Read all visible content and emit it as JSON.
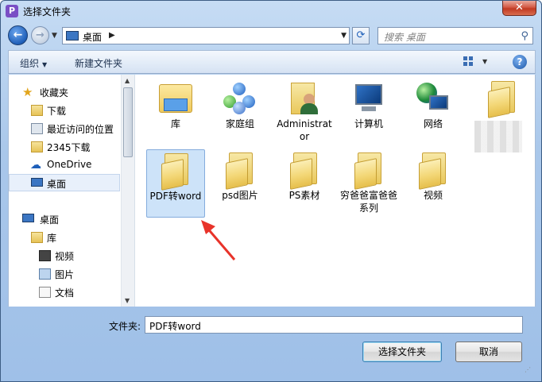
{
  "window": {
    "title": "选择文件夹",
    "app_icon_letter": "P",
    "close_glyph": "✕"
  },
  "address": {
    "location": "桌面",
    "search_placeholder": "搜索 桌面"
  },
  "toolbar": {
    "organize_label": "组织",
    "new_folder_label": "新建文件夹"
  },
  "nav_tree": [
    {
      "label": "收藏夹",
      "icon": "star-icon"
    },
    {
      "label": "下载",
      "icon": "download-folder-icon"
    },
    {
      "label": "最近访问的位置",
      "icon": "recent-places-icon"
    },
    {
      "label": "2345下载",
      "icon": "folder-icon"
    },
    {
      "label": "OneDrive",
      "icon": "cloud-icon"
    },
    {
      "label": "桌面",
      "icon": "desktop-icon",
      "selected": true
    },
    {
      "label": "桌面",
      "icon": "desktop-icon"
    },
    {
      "label": "库",
      "icon": "library-icon"
    },
    {
      "label": "视频",
      "icon": "video-icon"
    },
    {
      "label": "图片",
      "icon": "pictures-icon"
    },
    {
      "label": "文档",
      "icon": "documents-icon"
    }
  ],
  "items": [
    {
      "label": "库",
      "icon": "library-icon"
    },
    {
      "label": "家庭组",
      "icon": "homegroup-icon"
    },
    {
      "label": "Administrator",
      "icon": "user-folder-icon"
    },
    {
      "label": "计算机",
      "icon": "computer-icon"
    },
    {
      "label": "网络",
      "icon": "network-icon"
    },
    {
      "label": "",
      "icon": "folder-icon"
    },
    {
      "label": "PDF转word",
      "icon": "folder-icon",
      "selected": true
    },
    {
      "label": "psd图片",
      "icon": "folder-icon"
    },
    {
      "label": "PS素材",
      "icon": "folder-icon"
    },
    {
      "label": "穷爸爸富爸爸系列",
      "icon": "folder-icon"
    },
    {
      "label": "视频",
      "icon": "folder-icon"
    }
  ],
  "bottom": {
    "folder_label": "文件夹:",
    "folder_value": "PDF转word",
    "select_button": "选择文件夹",
    "cancel_button": "取消"
  },
  "colors": {
    "accent_arrow": "#e8332a",
    "selection": "#cde3f9"
  }
}
